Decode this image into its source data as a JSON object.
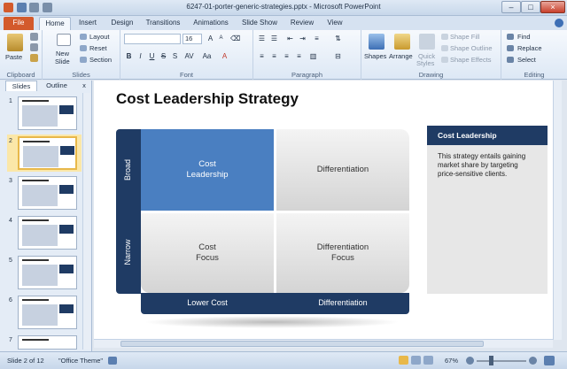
{
  "window": {
    "title": "6247-01-porter-generic-strategies.pptx - Microsoft PowerPoint"
  },
  "tabs": [
    "File",
    "Home",
    "Insert",
    "Design",
    "Transitions",
    "Animations",
    "Slide Show",
    "Review",
    "View"
  ],
  "ribbon": {
    "clipboard": {
      "label": "Clipboard",
      "paste": "Paste"
    },
    "slides": {
      "label": "Slides",
      "new_slide": "New",
      "new_slide2": "Slide",
      "layout": "Layout",
      "reset": "Reset",
      "section": "Section"
    },
    "font": {
      "label": "Font",
      "size": "16"
    },
    "paragraph": {
      "label": "Paragraph"
    },
    "drawing": {
      "label": "Drawing",
      "shapes": "Shapes",
      "arrange": "Arrange",
      "quick_styles": "Quick",
      "quick_styles2": "Styles",
      "shape_fill": "Shape Fill",
      "shape_outline": "Shape Outline",
      "shape_effects": "Shape Effects"
    },
    "editing": {
      "label": "Editing",
      "find": "Find",
      "replace": "Replace",
      "select": "Select"
    }
  },
  "panel": {
    "tabs": [
      "Slides",
      "Outline"
    ],
    "close": "x",
    "slide_numbers": [
      "1",
      "2",
      "3",
      "4",
      "5",
      "6",
      "7"
    ],
    "selected_index": 1
  },
  "slide": {
    "title": "Cost Leadership Strategy",
    "rows": [
      "Broad",
      "Narrow"
    ],
    "columns": [
      "Lower Cost",
      "Differentiation"
    ],
    "cells": {
      "top_left": [
        "Cost",
        "Leadership"
      ],
      "top_right": [
        "Differentiation"
      ],
      "bottom_left": [
        "Cost",
        "Focus"
      ],
      "bottom_right": [
        "Differentiation",
        "Focus"
      ]
    },
    "side_box": {
      "heading": "Cost Leadership",
      "body": "This strategy entails gaining market share by targeting price-sensitive  clients."
    }
  },
  "status": {
    "slide_info": "Slide 2 of 12",
    "theme": "\"Office Theme\"",
    "zoom": "67%"
  },
  "colors": {
    "navy": "#1f3b64",
    "blue": "#4a7fc1",
    "file_tab": "#d35a2c"
  }
}
